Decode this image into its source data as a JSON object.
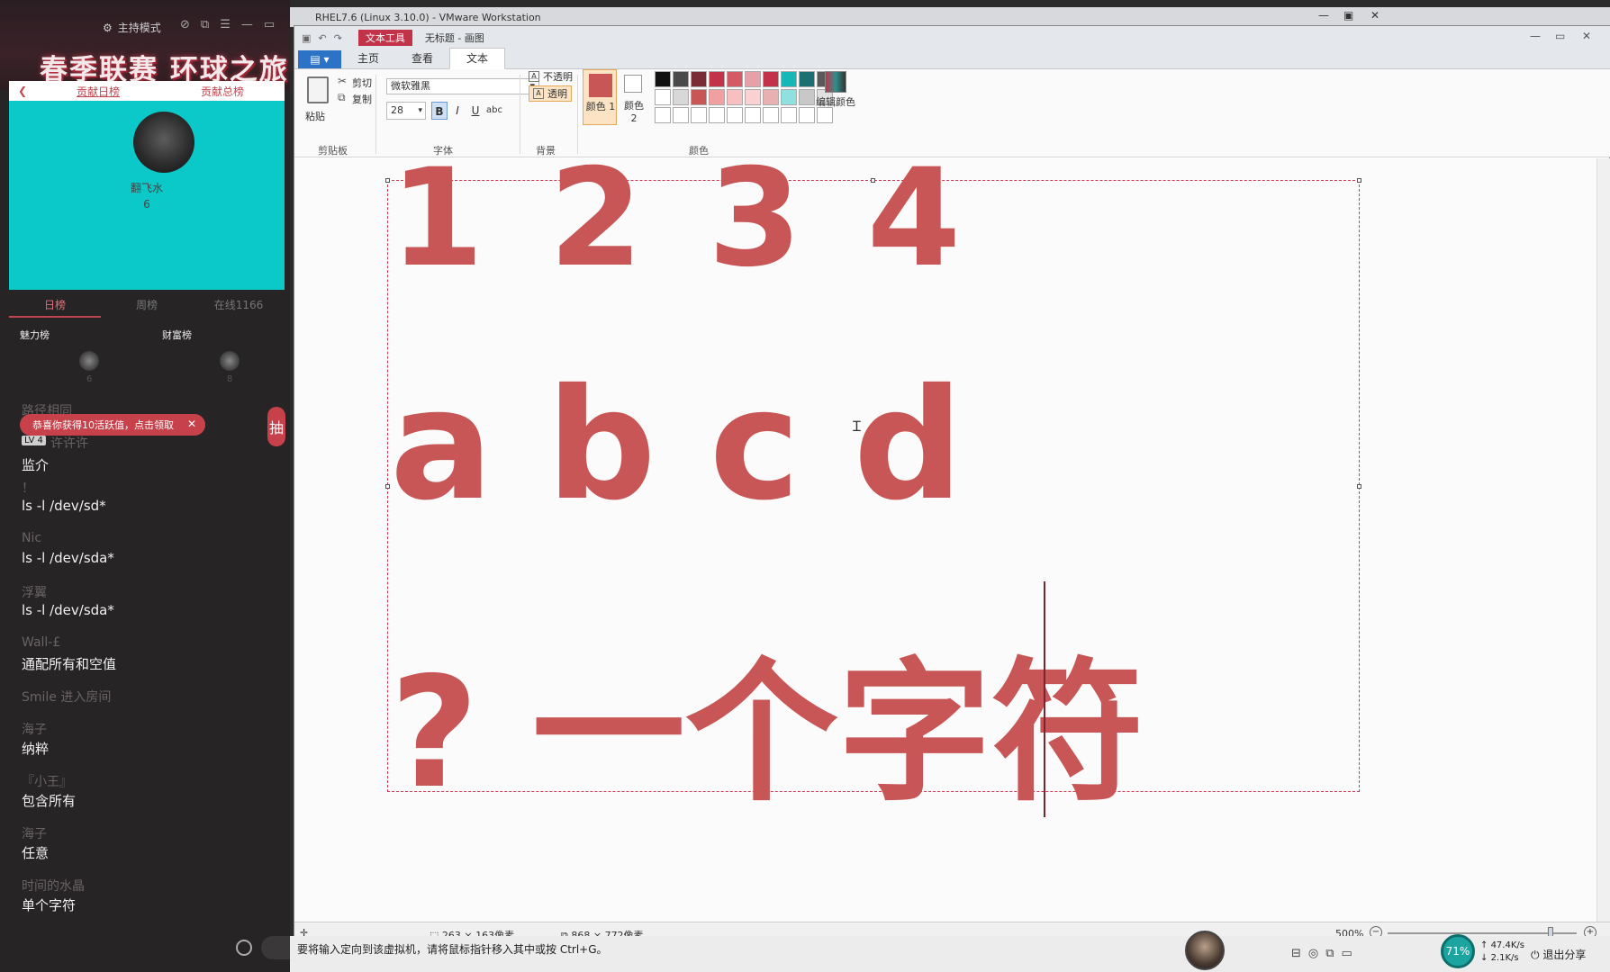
{
  "side": {
    "host_mode": "主持模式",
    "banner": "春季联赛 环球之旅",
    "tabs": [
      "贡献日榜",
      "贡献总榜"
    ],
    "top_user": {
      "name": "翻飞水",
      "count": "6"
    },
    "rank_tabs": [
      "日榜",
      "周榜",
      "在线1166"
    ],
    "boards": {
      "charm": "魅力榜",
      "rich": "财富榜",
      "charm_count": "6",
      "rich_count": "8"
    },
    "toast": "恭喜你获得10活跃值，点击领取",
    "lv_badge": "LV 4",
    "lv_user": "许许许",
    "draw_label": "抽",
    "messages": [
      {
        "user": "路径相同",
        "text": "监介"
      },
      {
        "user": "！",
        "text": "ls -l /dev/sd*"
      },
      {
        "user": "Nic",
        "text": "ls -l /dev/sda*"
      },
      {
        "user": "浮翼",
        "text": "ls -l /dev/sda*"
      },
      {
        "user": "Wall-£",
        "text": "通配所有和空值"
      },
      {
        "user": "Smile 进入房间",
        "text": ""
      },
      {
        "user": "海子",
        "text": "纳粹"
      },
      {
        "user": "『小王』",
        "text": "包含所有"
      },
      {
        "user": "海子",
        "text": "任意"
      },
      {
        "user": "时间的水晶",
        "text": "单个字符"
      }
    ]
  },
  "vm": {
    "title": "RHEL7.6 (Linux 3.10.0) - VMware Workstation",
    "qa_title": "无标题 - 画图",
    "context_tab": "文本工具",
    "tabs": [
      "主页",
      "查看",
      "文本"
    ],
    "file_button": "▤ ▾",
    "clipboard": {
      "paste": "粘贴",
      "cut": "剪切",
      "copy": "复制",
      "group": "剪贴板"
    },
    "font": {
      "name": "微软雅黑",
      "size": "28",
      "group": "字体",
      "bold": "B",
      "italic": "I",
      "underline": "U",
      "strike": "abc"
    },
    "background": {
      "opaque": "不透明",
      "transparent": "透明",
      "group": "背景"
    },
    "colors": {
      "color1_label": "颜色 1",
      "color2_label": "颜色 2",
      "group": "颜色",
      "edit": "编辑颜色",
      "color1": "#c95656",
      "color2": "#ffffff",
      "palette": [
        "#111111",
        "#4a4a4a",
        "#7a2b35",
        "#c2334a",
        "#d45a66",
        "#e8a0a8",
        "#c2334a",
        "#16b8b6",
        "#1d6f72",
        "#5a5a5a",
        "#ffffff",
        "#d8d8d8",
        "#c95656",
        "#f0a0a0",
        "#f7c0c0",
        "#fbd0d0",
        "#e8b0b0",
        "#8fe0de",
        "#c8c8c8",
        "#e0e0e0",
        "#ffffff",
        "#ffffff",
        "#ffffff",
        "#ffffff",
        "#ffffff",
        "#ffffff",
        "#ffffff",
        "#ffffff",
        "#ffffff",
        "#ffffff"
      ]
    },
    "canvas": {
      "line1": "1 2 3 4",
      "line2": "a b c d",
      "line3": "? 一个字符"
    },
    "status": {
      "selection": "263 × 163像素",
      "size": "868 × 772像素",
      "zoom": "500%"
    },
    "hint": "要将输入定向到该虚拟机，请将鼠标指针移入其中或按 Ctrl+G。"
  },
  "tray": {
    "net_percent": "71%",
    "up": "47.4K/s",
    "down": "2.1K/s",
    "exit": "退出分享"
  }
}
